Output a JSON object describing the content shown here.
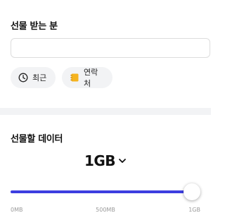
{
  "recipient": {
    "title": "선물 받는 분",
    "input_placeholder": "",
    "input_value": "",
    "recent_label": "최근",
    "contacts_label": "연락처"
  },
  "gift": {
    "title": "선물할 데이터",
    "amount": "1GB",
    "slider": {
      "value_fraction": 1.0,
      "min_label": "0MB",
      "mid_label": "500MB",
      "max_label": "1GB"
    }
  },
  "colors": {
    "accent": "#3d3ee0",
    "chip_bg": "#f2f3f5",
    "contact_icon": "#f5b31f"
  },
  "icons": {
    "recent": "clock-icon",
    "contacts": "address-book-icon",
    "amount_toggle": "chevron-down-icon"
  }
}
